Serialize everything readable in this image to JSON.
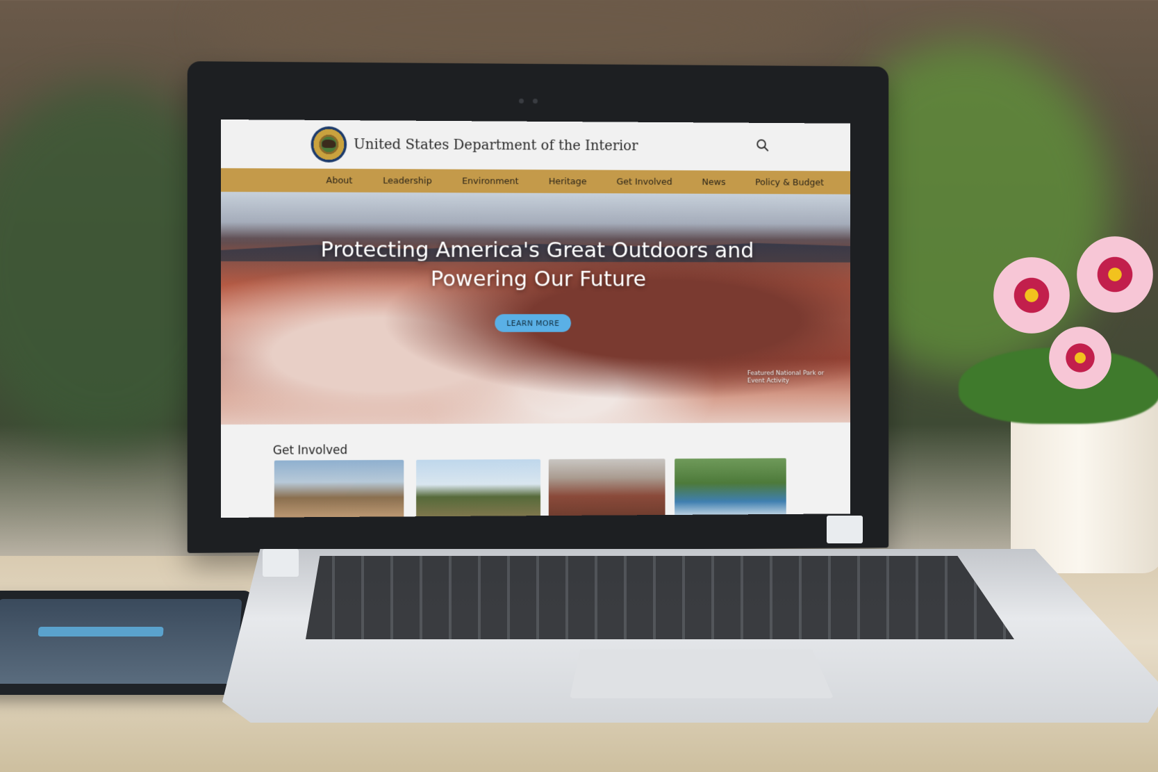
{
  "site": {
    "agency_name": "United States Department of the Interior",
    "search_icon": "search-icon",
    "seal_icon": "department-seal-icon"
  },
  "nav": {
    "items": [
      {
        "label": "About"
      },
      {
        "label": "Leadership"
      },
      {
        "label": "Environment"
      },
      {
        "label": "Heritage"
      },
      {
        "label": "Get Involved"
      },
      {
        "label": "News"
      },
      {
        "label": "Policy & Budget"
      }
    ]
  },
  "hero": {
    "title": "Protecting America's Great Outdoors and Powering Our Future",
    "cta_label": "LEARN MORE",
    "caption": "Featured National Park or Event Activity"
  },
  "get_involved": {
    "title": "Get Involved"
  },
  "colors": {
    "nav_gold": "#c49a4a",
    "cta_blue": "#5ab0e6",
    "header_bg": "#f1f1f1"
  }
}
